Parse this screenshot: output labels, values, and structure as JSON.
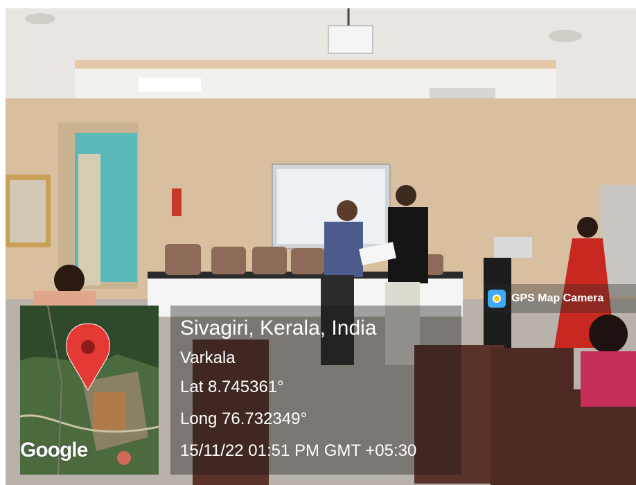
{
  "overlay": {
    "app_badge": "GPS Map Camera",
    "map_logo": "Google",
    "location": "Sivagiri, Kerala, India",
    "city": "Varkala",
    "latitude": "Lat 8.745361°",
    "longitude": "Long 76.732349°",
    "datetime": "15/11/22 01:51 PM GMT +05:30"
  }
}
